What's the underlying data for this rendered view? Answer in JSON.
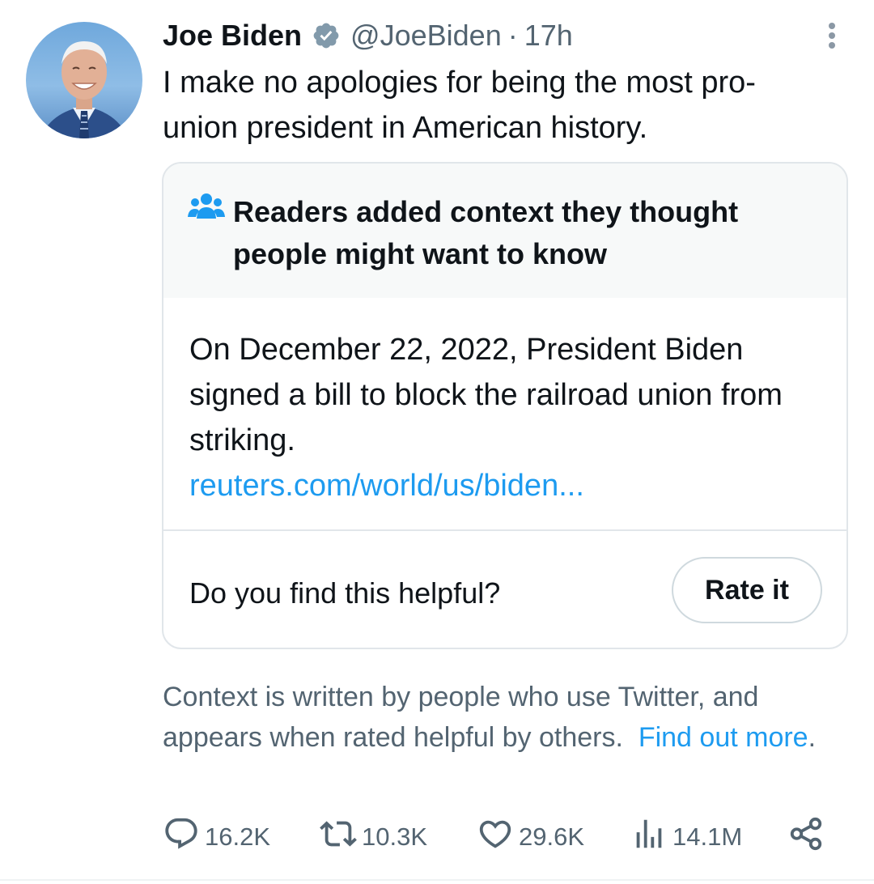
{
  "tweet": {
    "author": {
      "name": "Joe Biden",
      "handle": "@JoeBiden",
      "separator": "·",
      "time": "17h"
    },
    "text": "I make no apologies for being the most pro-union president in American history."
  },
  "community_note": {
    "header": "Readers added context they thought people might want to know",
    "body": "On December 22, 2022, President Biden signed a bill to block the railroad union from striking.",
    "link_text": "reuters.com/world/us/biden...",
    "helpful_question": "Do you find this helpful?",
    "rate_button": "Rate it"
  },
  "context_footer": {
    "text": "Context is written by people who use Twitter, and appears when rated helpful by others.",
    "link_text": "Find out more",
    "end": "."
  },
  "actions": {
    "replies": "16.2K",
    "retweets": "10.3K",
    "likes": "29.6K",
    "views": "14.1M"
  },
  "icons": {
    "verified": "verified-badge-icon",
    "more": "more-options-icon",
    "note": "community-notes-icon",
    "reply": "reply-icon",
    "retweet": "retweet-icon",
    "like": "heart-icon",
    "views": "views-icon",
    "share": "share-icon"
  },
  "colors": {
    "text_primary": "#0f1419",
    "text_secondary": "#536471",
    "link": "#1d9bf0",
    "note_header_bg": "#f7f9f9",
    "border": "#e1e6ea"
  }
}
